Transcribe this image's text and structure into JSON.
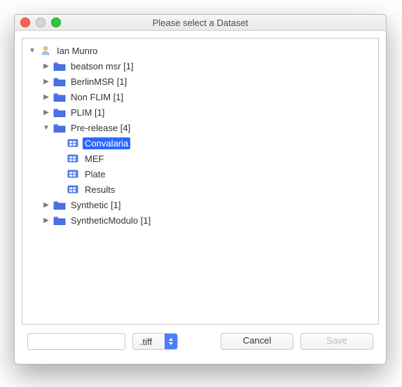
{
  "window": {
    "title": "Please select a Dataset"
  },
  "tree": {
    "root": {
      "label": "Ian Munro",
      "expanded": true,
      "children": [
        {
          "label": "beatson msr [1]"
        },
        {
          "label": "BerlinMSR [1]"
        },
        {
          "label": "Non FLIM [1]"
        },
        {
          "label": "PLIM [1]"
        },
        {
          "label": "Pre-release [4]",
          "expanded": true,
          "children": [
            {
              "label": "Convalaria",
              "selected": true
            },
            {
              "label": "MEF"
            },
            {
              "label": "Plate"
            },
            {
              "label": "Results"
            }
          ]
        },
        {
          "label": "Synthetic [1]"
        },
        {
          "label": "SyntheticModulo [1]"
        }
      ]
    }
  },
  "footer": {
    "filename": "",
    "format": ".tiff",
    "cancel": "Cancel",
    "save": "Save"
  }
}
